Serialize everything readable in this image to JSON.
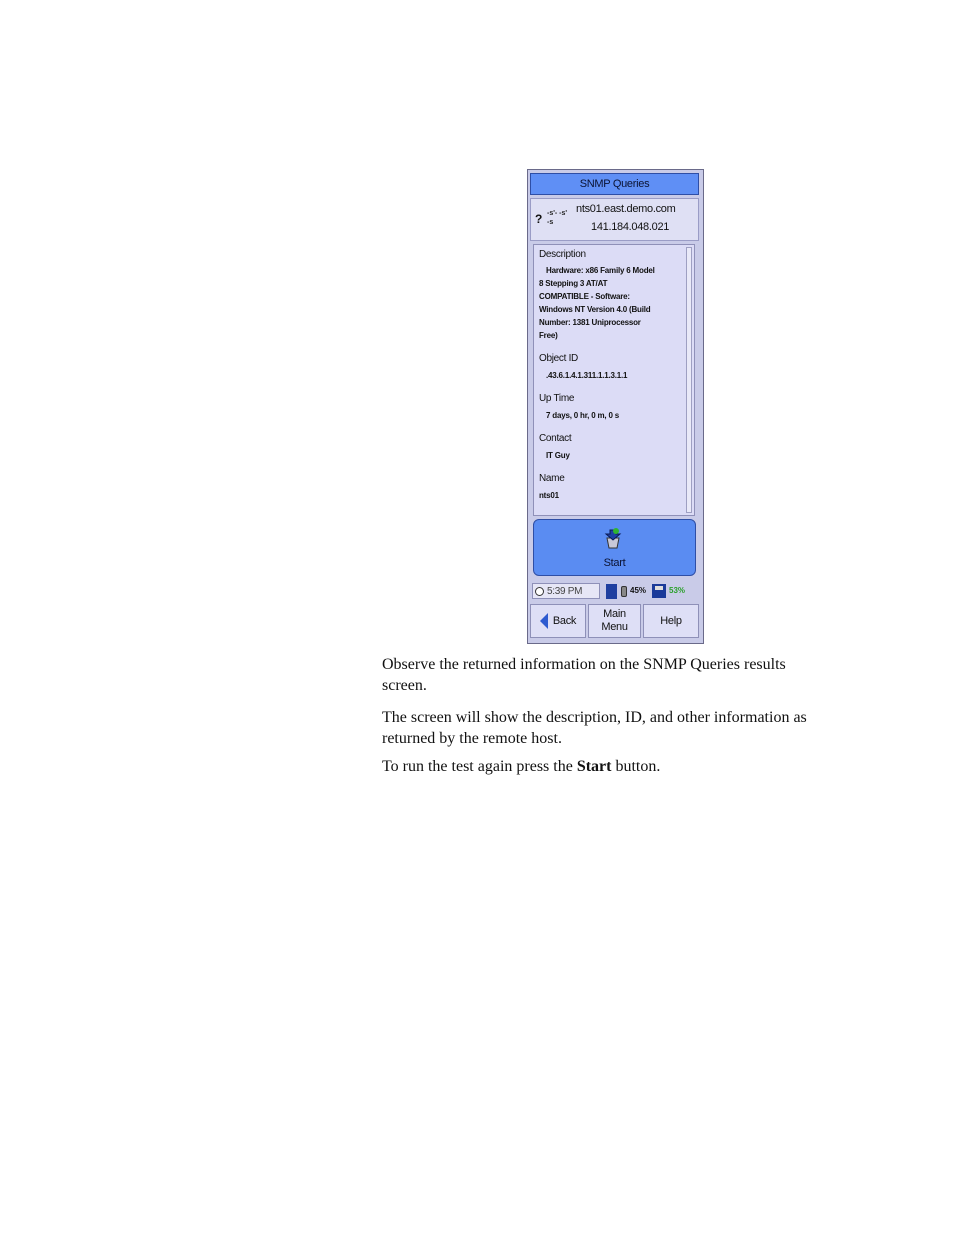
{
  "device": {
    "title": "SNMP Queries",
    "host": {
      "icon_symbol": "?",
      "icon_fraction_top": "-s'- -s'",
      "icon_fraction_bottom": "-s",
      "name": "nts01.east.demo.com",
      "ip": "141.184.048.021"
    },
    "fields": [
      {
        "label": "Description",
        "lines": [
          "Hardware: x86 Family 6 Model",
          "8 Stepping 3 AT/AT",
          "COMPATIBLE - Software:",
          "Windows NT Version 4.0 (Build",
          "Number: 1381 Uniprocessor",
          "Free)"
        ]
      },
      {
        "label": "Object ID",
        "lines": [
          ".43.6.1.4.1.311.1.1.3.1.1"
        ]
      },
      {
        "label": "Up Time",
        "lines": [
          "7 days, 0 hr, 0 m, 0 s"
        ]
      },
      {
        "label": "Contact",
        "lines": [
          "IT Guy"
        ]
      },
      {
        "label": "Name",
        "lines": [
          "nts01"
        ]
      }
    ],
    "start_label": "Start",
    "status": {
      "time": "5:39 PM",
      "battery_pct": "45%",
      "disk_pct": "53%"
    },
    "nav": {
      "back": "Back",
      "main_menu_line1": "Main",
      "main_menu_line2": "Menu",
      "help": "Help"
    }
  },
  "text": {
    "p1": "Observe the returned information on the SNMP Queries results screen.",
    "p2": "The screen will show the description, ID, and other information as returned by the remote host.",
    "p3_before": "To run the test again press the ",
    "p3_bold": "Start",
    "p3_after": " button."
  },
  "colors": {
    "title_bar": "#5f8ff5",
    "panel_bg": "#dcdcf6",
    "start_button": "#5a8cf2",
    "disk_pct": "#2aa02a"
  }
}
